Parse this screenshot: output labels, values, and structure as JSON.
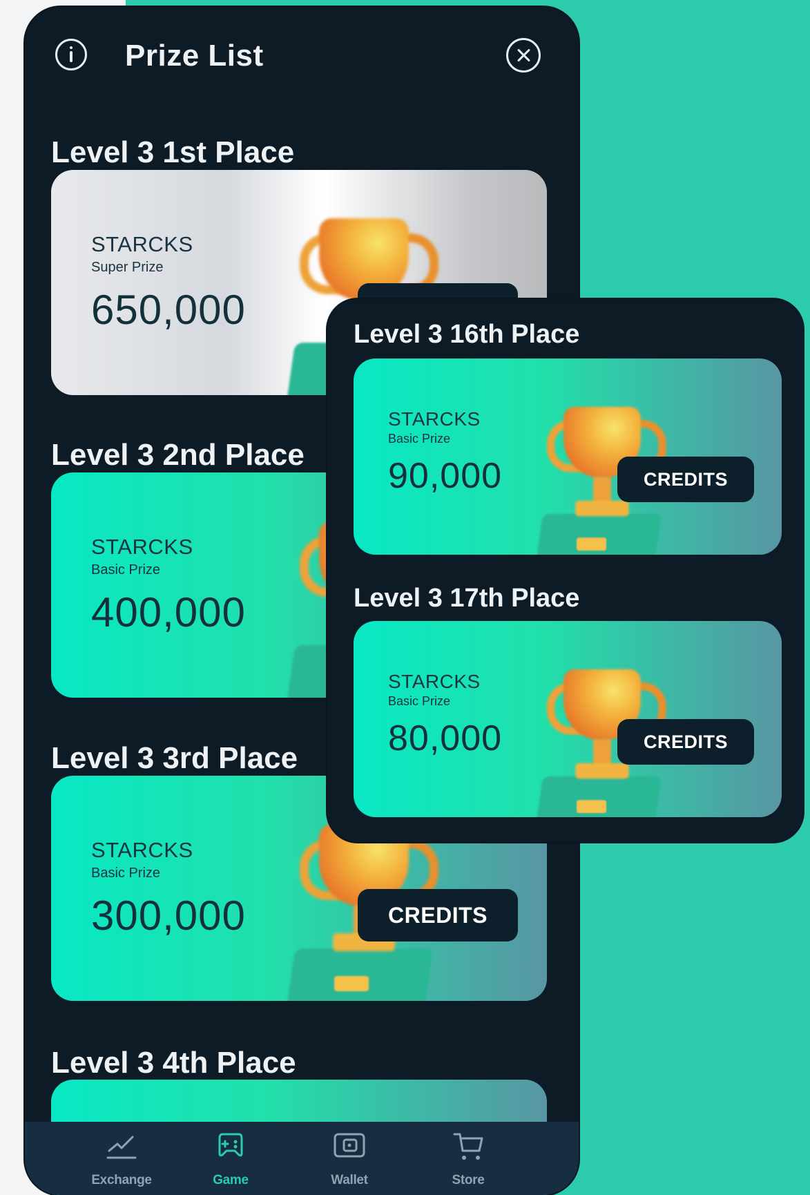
{
  "header": {
    "title": "Prize List"
  },
  "prizes": [
    {
      "title": "Level 3 1st Place",
      "brand": "STARCKS",
      "tier": "Super Prize",
      "amount": "650,000"
    },
    {
      "title": "Level 3 2nd Place",
      "brand": "STARCKS",
      "tier": "Basic Prize",
      "amount": "400,000"
    },
    {
      "title": "Level 3 3rd Place",
      "brand": "STARCKS",
      "tier": "Basic Prize",
      "amount": "300,000",
      "button": "CREDITS"
    },
    {
      "title": "Level 3 4th Place"
    }
  ],
  "popup": {
    "prizes": [
      {
        "title": "Level 3 16th Place",
        "brand": "STARCKS",
        "tier": "Basic Prize",
        "amount": "90,000",
        "button": "CREDITS"
      },
      {
        "title": "Level 3 17th Place",
        "brand": "STARCKS",
        "tier": "Basic Prize",
        "amount": "80,000",
        "button": "CREDITS"
      }
    ]
  },
  "nav": {
    "items": [
      {
        "label": "Exchange",
        "icon": "chart-icon"
      },
      {
        "label": "Game",
        "icon": "gamepad-icon",
        "active": true
      },
      {
        "label": "Wallet",
        "icon": "wallet-icon"
      },
      {
        "label": "Store",
        "icon": "cart-icon"
      }
    ]
  },
  "colors": {
    "background": "#2ccbab",
    "panel": "#0d1b27",
    "navbar": "#172d42",
    "accent": "#2ccbab"
  }
}
